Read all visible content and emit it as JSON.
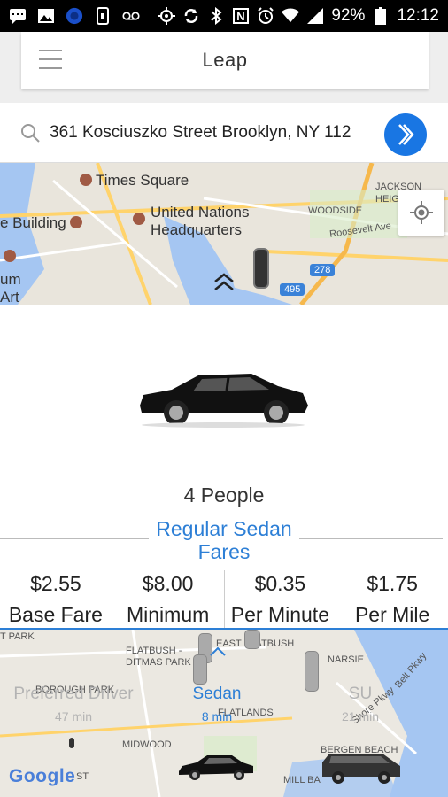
{
  "status_bar": {
    "battery": "92%",
    "time": "12:12",
    "carrier_n": "N"
  },
  "header": {
    "title": "Leap"
  },
  "search": {
    "value": "361 Kosciuszko Street Brooklyn, NY 112",
    "placeholder": ""
  },
  "map_top": {
    "labels": {
      "times_square": "Times Square",
      "building": "e Building",
      "un_line1": "United Nations",
      "un_line2": "Headquarters",
      "woodside": "WOODSIDE",
      "jackson1": "JACKSON",
      "jackson2": "HEIG",
      "roosevelt": "Roosevelt Ave",
      "um": "um",
      "art": "Art",
      "hwy_278": "278",
      "hwy_495": "495"
    }
  },
  "vehicle": {
    "capacity": "4 People",
    "fares_title_line1": "Regular Sedan",
    "fares_title_line2": "Fares",
    "fares": [
      {
        "value": "$2.55",
        "label": "Base Fare"
      },
      {
        "value": "$8.00",
        "label": "Minimum"
      },
      {
        "value": "$0.35",
        "label": "Per Minute"
      },
      {
        "value": "$1.75",
        "label": "Per Mile"
      }
    ]
  },
  "map_bottom": {
    "labels": {
      "park": "T PARK",
      "east_flatbush": "EAST FLATBUSH",
      "flatbush_ditmas1": "FLATBUSH -",
      "flatbush_ditmas2": "DITMAS PARK",
      "canarsie": "NARSIE",
      "borough_park": "BOROUGH PARK",
      "flatlands": "FLATLANDS",
      "midwood": "MIDWOOD",
      "bergen_beach": "BERGEN BEACH",
      "mill_basin": "MILL BA",
      "belt_pkwy": "Belt Pkwy",
      "shore": "Shore Pkwy",
      "st": "ST"
    },
    "options": [
      {
        "name": "Preferred Driver",
        "eta": "47 min",
        "color": "#b3b3b3"
      },
      {
        "name": "Sedan",
        "eta": "8 min",
        "color": "#2d7fd6"
      },
      {
        "name": "SU",
        "eta": "21 min",
        "color": "#b3b3b3"
      }
    ],
    "google": "Google"
  },
  "colors": {
    "accent": "#1976e3",
    "link": "#2d7fd6"
  }
}
